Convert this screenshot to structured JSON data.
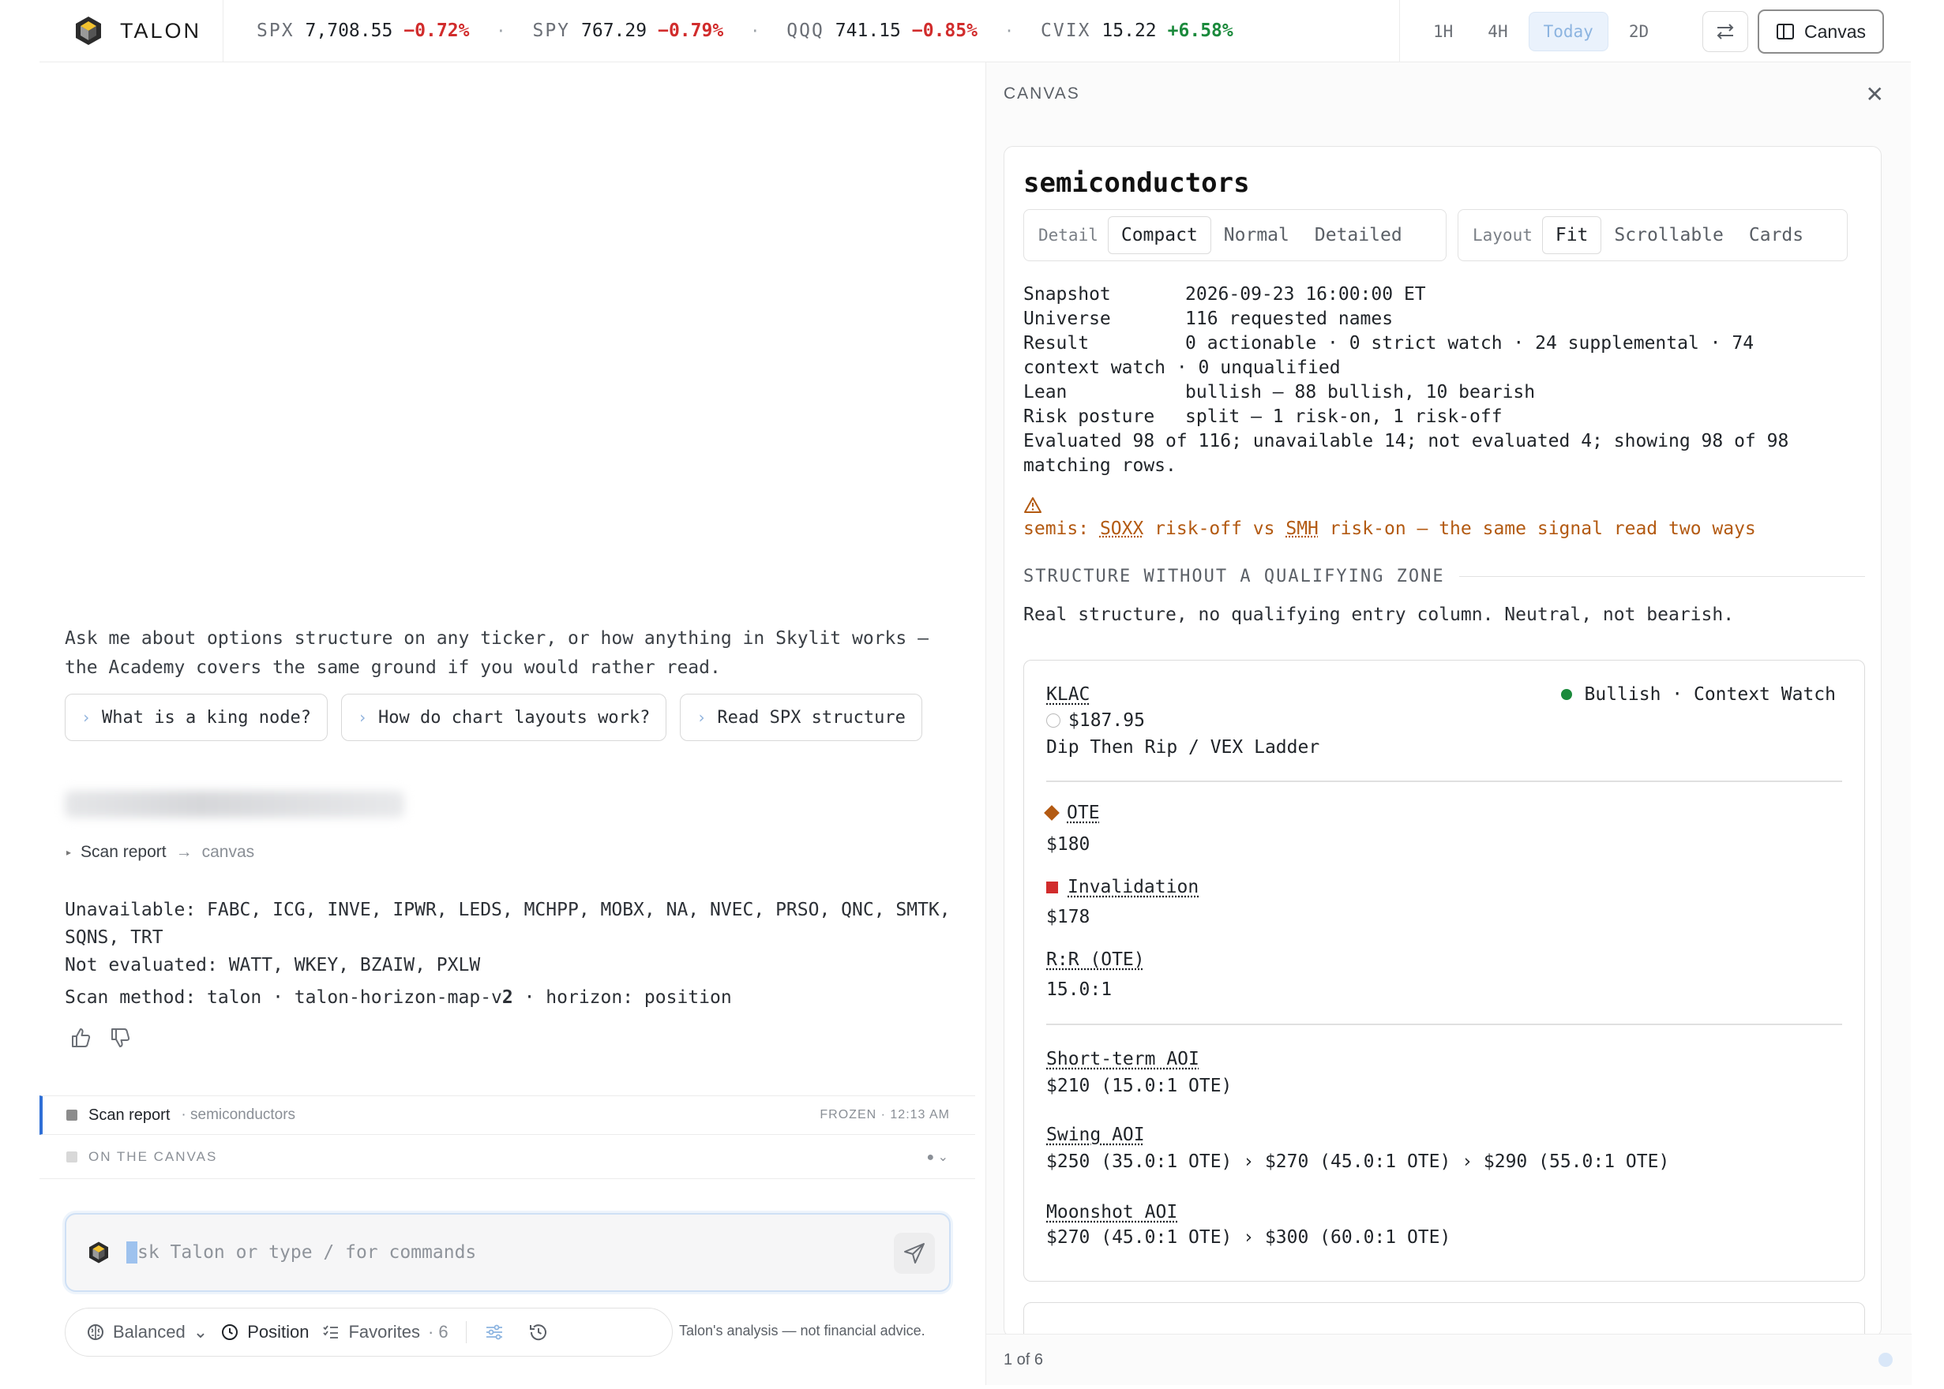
{
  "brand": {
    "name": "TALON"
  },
  "ticker": [
    {
      "symbol": "SPX",
      "price": "7,708.55",
      "change": "−0.72%",
      "direction": "neg"
    },
    {
      "symbol": "SPY",
      "price": "767.29",
      "change": "−0.79%",
      "direction": "neg"
    },
    {
      "symbol": "QQQ",
      "price": "741.15",
      "change": "−0.85%",
      "direction": "neg"
    },
    {
      "symbol": "CVIX",
      "price": "15.22",
      "change": "+6.58%",
      "direction": "pos"
    }
  ],
  "ticker_separator": "·",
  "time_tabs": [
    "1H",
    "4H",
    "Today",
    "2D"
  ],
  "time_tab_active": "Today",
  "header": {
    "canvas_button": "Canvas"
  },
  "chat": {
    "intro": "Ask me about options structure on any ticker, or how anything in Skylit works — the Academy covers the same ground if you would rather read.",
    "suggestions": [
      "What is a king node?",
      "How do chart layouts work?",
      "Read SPX structure"
    ],
    "scan_toggle": {
      "label": "Scan report",
      "target": "canvas"
    },
    "unavailable_line": "Unavailable: FABC, ICG, INVE, IPWR, LEDS, MCHPP, MOBX, NA, NVEC, PRSO, QNC, SMTK, SQNS, TRT",
    "not_evaluated_line": "Not evaluated: WATT, WKEY, BZAIW, PXLW",
    "method": {
      "prefix": "Scan method: talon · talon-horizon-map-v",
      "version": "2",
      "suffix": " · horizon: position"
    },
    "report_row": {
      "label": "Scan report",
      "sub": "· semiconductors",
      "status": "FROZEN · 12:13 AM"
    },
    "canvas_row": {
      "label": "ON THE CANVAS"
    },
    "composer": {
      "placeholder": "sk Talon or type / for commands"
    },
    "toolbar": {
      "mode": "Balanced",
      "horizon": "Position",
      "favorites": "Favorites",
      "favorites_count": "· 6"
    },
    "disclaimer": "Talon's analysis — not financial advice."
  },
  "canvas": {
    "header": "CANVAS",
    "title": "semiconductors",
    "detail": {
      "label": "Detail",
      "options": [
        "Compact",
        "Normal",
        "Detailed"
      ],
      "active": "Compact"
    },
    "layout": {
      "label": "Layout",
      "options": [
        "Fit",
        "Scrollable",
        "Cards"
      ],
      "active": "Fit"
    },
    "summary": {
      "snapshot_k": "Snapshot",
      "snapshot_v": "2026-09-23 16:00:00 ET",
      "universe_k": "Universe",
      "universe_v": "116 requested names",
      "result_k": "Result",
      "result_v": "0 actionable · 0 strict watch · 24 supplemental · 74",
      "result_cont": "context watch · 0 unqualified",
      "lean_k": "Lean",
      "lean_v": "bullish — 88 bullish, 10 bearish",
      "risk_k": "Risk posture",
      "risk_v": "split — 1 risk-on, 1 risk-off",
      "evaluated_1": "Evaluated 98 of 116; unavailable 14; not evaluated 4; showing 98 of 98",
      "evaluated_2": "matching rows."
    },
    "warning": {
      "prefix": "semis: ",
      "a": "SOXX",
      "mid1": " risk-off vs ",
      "b": "SMH",
      "mid2": " risk-on — the same signal read two ways"
    },
    "section": {
      "title": "STRUCTURE WITHOUT A QUALIFYING ZONE",
      "desc": "Real structure, no qualifying entry column. Neutral, not bearish."
    },
    "card": {
      "ticker": "KLAC",
      "price": "$187.95",
      "strategy": "Dip Then Rip / VEX Ladder",
      "status": "Bullish · Context Watch",
      "ote_label": "OTE",
      "ote_value": "$180",
      "inv_label": "Invalidation",
      "inv_value": "$178",
      "rr_label": "R:R (OTE)",
      "rr_value": "15.0:1",
      "short_label": "Short-term AOI",
      "short_value": "$210 (15.0:1 OTE)",
      "swing_label": "Swing AOI",
      "swing_value": "$250 (35.0:1 OTE) › $270 (45.0:1 OTE) › $290 (55.0:1 OTE)",
      "moon_label": "Moonshot AOI",
      "moon_value": "$270 (45.0:1 OTE) › $300 (60.0:1 OTE)"
    },
    "pager": "1 of 6"
  }
}
